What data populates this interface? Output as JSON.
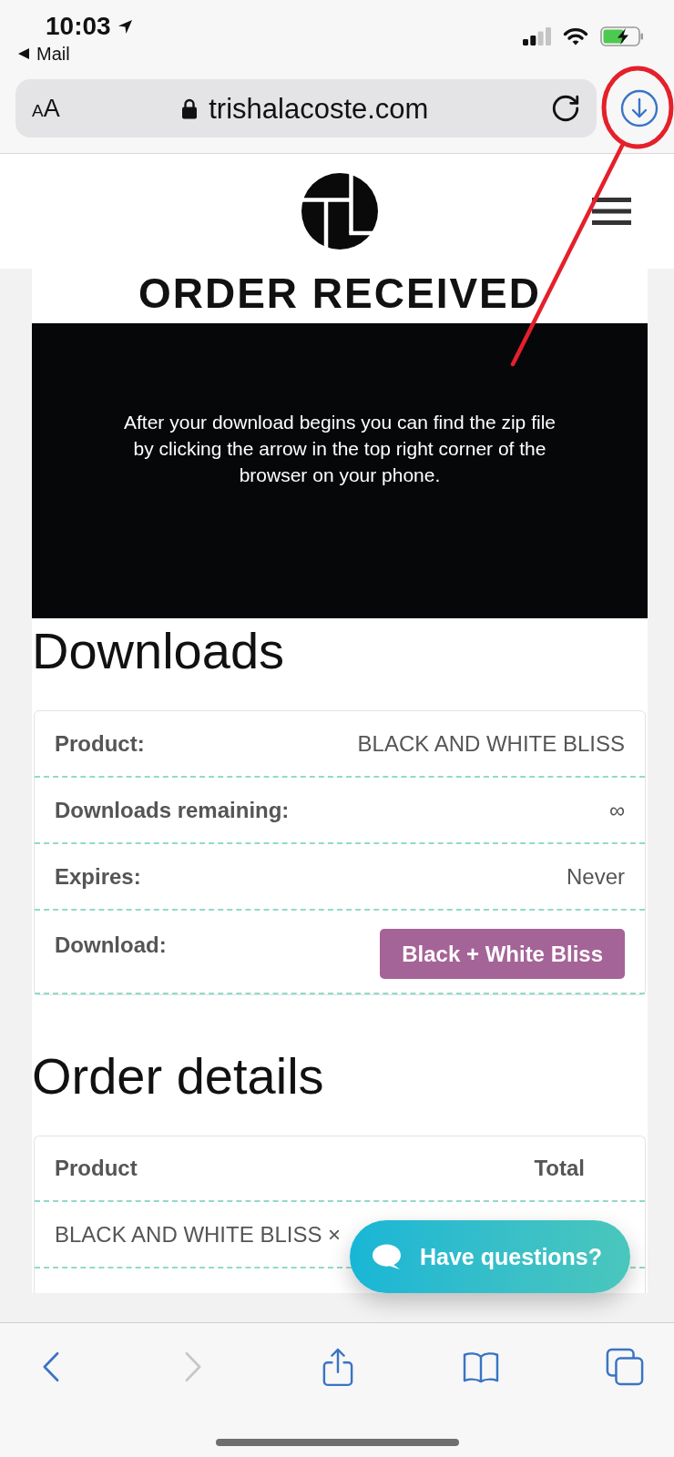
{
  "status_bar": {
    "time": "10:03",
    "back_label": "Mail"
  },
  "browser_bar": {
    "text_size_button": "AA",
    "url": "trishalacoste.com"
  },
  "page": {
    "heading": "ORDER RECEIVED",
    "notice": "After your download begins you can find the zip file by clicking the arrow in the top right corner of the browser on your phone.",
    "downloads": {
      "title": "Downloads",
      "rows": [
        {
          "kind": "text",
          "label": "Product:",
          "value": "BLACK AND WHITE BLISS"
        },
        {
          "kind": "text",
          "label": "Downloads remaining:",
          "value": "∞"
        },
        {
          "kind": "text",
          "label": "Expires:",
          "value": "Never"
        },
        {
          "kind": "button",
          "label": "Download:",
          "value": "Black + White Bliss"
        }
      ]
    },
    "order_details": {
      "title": "Order details",
      "columns": [
        "Product",
        "Total"
      ],
      "rows": [
        {
          "product": "BLACK AND WHITE BLISS ×"
        }
      ]
    }
  },
  "chat_button": {
    "label": "Have questions?"
  },
  "toolbar": {
    "buttons": [
      {
        "kind": "back",
        "disabled": false
      },
      {
        "kind": "forward",
        "disabled": true
      },
      {
        "kind": "share",
        "disabled": false
      },
      {
        "kind": "bookmarks",
        "disabled": false
      },
      {
        "kind": "tabs",
        "disabled": false
      }
    ]
  }
}
